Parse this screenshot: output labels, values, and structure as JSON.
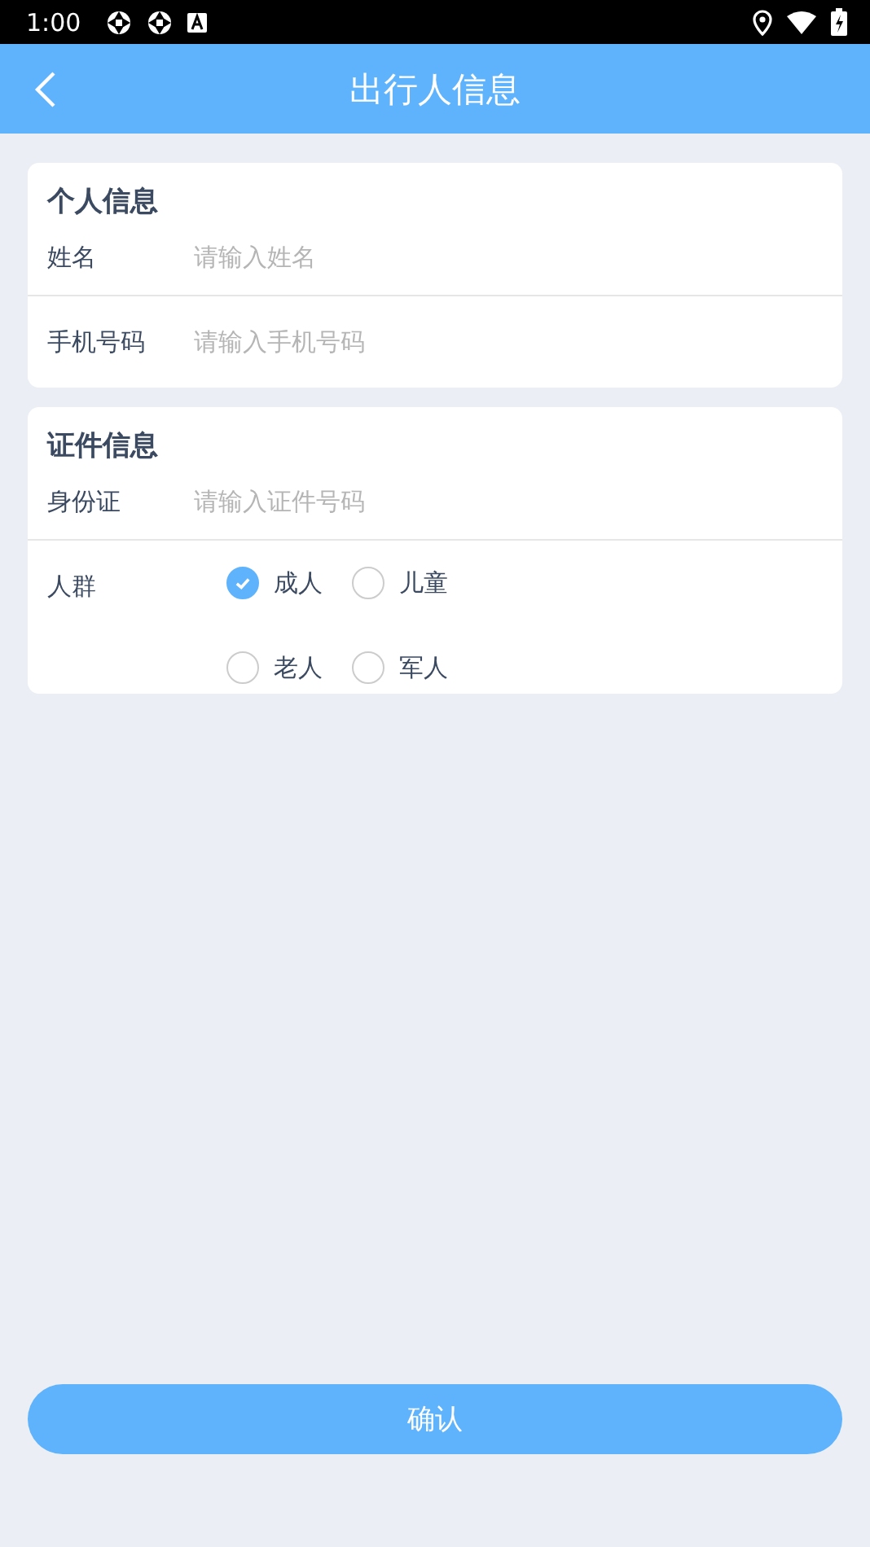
{
  "status_bar": {
    "time": "1:00"
  },
  "header": {
    "title": "出行人信息"
  },
  "sections": [
    {
      "title": "个人信息",
      "fields": [
        {
          "label": "姓名",
          "placeholder": "请输入姓名"
        },
        {
          "label": "手机号码",
          "placeholder": "请输入手机号码"
        }
      ]
    },
    {
      "title": "证件信息",
      "fields": [
        {
          "label": "身份证",
          "placeholder": "请输入证件号码"
        }
      ],
      "radio_group": {
        "label": "人群",
        "options": [
          {
            "label": "成人",
            "selected": true
          },
          {
            "label": "儿童",
            "selected": false
          },
          {
            "label": "老人",
            "selected": false
          },
          {
            "label": "军人",
            "selected": false
          }
        ]
      }
    }
  ],
  "confirm_button": "确认"
}
